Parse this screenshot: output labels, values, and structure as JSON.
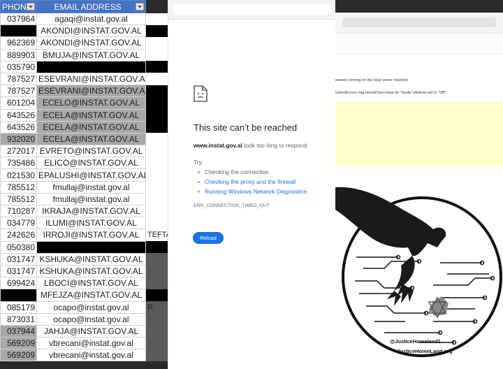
{
  "sheet": {
    "headers": {
      "phone": "PHONE",
      "email": "EMAIL ADDRESS"
    },
    "rows": [
      {
        "phone": "037964",
        "email": "agaqi@instat.gov.al",
        "extra": "",
        "style": "wh"
      },
      {
        "phone": "",
        "email": "AKONDI@INSTAT.GOV.AL",
        "extra": "",
        "style": "bkphone"
      },
      {
        "phone": "962369",
        "email": "AKONDI@INSTAT.GOV.AL",
        "extra": "",
        "style": "wh"
      },
      {
        "phone": "889903",
        "email": "BMUJA@INSTAT.GOV.AL",
        "extra": "",
        "style": "wh"
      },
      {
        "phone": "035790",
        "email": "",
        "extra": "",
        "style": "bkemail"
      },
      {
        "phone": "787527",
        "email": "ESEVRANI@INSTAT.GOV.AL",
        "extra": "",
        "style": "wh"
      },
      {
        "phone": "787527",
        "email": "ESEVRANI@INSTAT.GOV.AL",
        "extra": "",
        "style": "gr"
      },
      {
        "phone": "601204",
        "email": "ECELO@INSTAT.GOV.AL",
        "extra": "",
        "style": "gr"
      },
      {
        "phone": "643526",
        "email": "ECELA@INSTAT.GOV.AL",
        "extra": "",
        "style": "gr"
      },
      {
        "phone": "643526",
        "email": "ECELA@INSTAT.GOV.AL",
        "extra": "",
        "style": "gr"
      },
      {
        "phone": "932020",
        "email": "ECELA@INSTAT.GOV.AL",
        "extra": "",
        "style": "grall"
      },
      {
        "phone": "272017",
        "email": "EVRETO@INSTAT.GOV.AL",
        "extra": "",
        "style": "wh"
      },
      {
        "phone": "735486",
        "email": "ELICO@INSTAT.GOV.AL",
        "extra": "",
        "style": "wh"
      },
      {
        "phone": "021530",
        "email": "EPALUSHI@INSTAT.GOV.AL",
        "extra": "",
        "style": "wh"
      },
      {
        "phone": "785512",
        "email": "fmullaj@instat.gov.al",
        "extra": "",
        "style": "wh"
      },
      {
        "phone": "785512",
        "email": "fmullaj@instat.gov.al",
        "extra": "",
        "style": "wh"
      },
      {
        "phone": "710287",
        "email": "IKRAJA@INSTAT.GOV.AL",
        "extra": "",
        "style": "wh"
      },
      {
        "phone": "034779",
        "email": "ILUMI@INSTAT.GOV.AL",
        "extra": "",
        "style": "wh"
      },
      {
        "phone": "242626",
        "email": "IRROJI@INSTAT.GOV.AL",
        "extra": "TEFTA",
        "style": "wh"
      },
      {
        "phone": "050380",
        "email": "",
        "extra": "",
        "style": "bkemail"
      },
      {
        "phone": "031747",
        "email": "KSHUKA@INSTAT.GOV.AL",
        "extra": "",
        "style": "wh"
      },
      {
        "phone": "031747",
        "email": "KSHUKA@INSTAT.GOV.AL",
        "extra": "",
        "style": "wh"
      },
      {
        "phone": "699424",
        "email": "LBOCI@INSTAT.GOV.AL",
        "extra": "",
        "style": "wh"
      },
      {
        "phone": "",
        "email": "MFEJZA@INSTAT.GOV.AL",
        "extra": "",
        "style": "bkphone"
      },
      {
        "phone": "085179",
        "email": "ocapo@instat.gov.al",
        "extra": "R",
        "style": "wh"
      },
      {
        "phone": "873031",
        "email": "ocapo@instat.gov.al",
        "extra": "",
        "style": "wh"
      },
      {
        "phone": "037944",
        "email": "JAHJA@INSTAT.GOV.AL",
        "extra": "",
        "style": "grphone"
      },
      {
        "phone": "569209",
        "email": "vbrecani@instat.gov.al",
        "extra": "",
        "style": "grphone"
      },
      {
        "phone": "569209",
        "email": "vbrecani@instat.gov.al",
        "extra": "",
        "style": "grphone"
      }
    ]
  },
  "browser": {
    "title": "This site can’t be reached",
    "host": "www.instat.gov.al",
    "desc_rest": " took too long to respond.",
    "try_label": "Try:",
    "suggestions": [
      {
        "text": "Checking the connection",
        "link": false
      },
      {
        "text": "Checking the proxy and the firewall",
        "link": true
      },
      {
        "text": "Running Windows Network Diagnostics",
        "link": true
      }
    ],
    "error_code": "ERR_CONNECTION_TIMED_OUT",
    "reload_label": "Reload"
  },
  "deface": {
    "line1": "owsers running on the local server machine.",
    "line2": "ustomErrors> tag should then have its \"mode\" attribute set to \"Off\".",
    "handle": "@JusticeHomeland1",
    "site": "JusticeHomeLand.org",
    "colors": {
      "yellow": "#ffffcc",
      "seal_outline": "#111111"
    }
  },
  "colors": {
    "header_blue": "#4472c4",
    "link_blue": "#1a73e8",
    "reload_blue": "#1a73e8"
  }
}
